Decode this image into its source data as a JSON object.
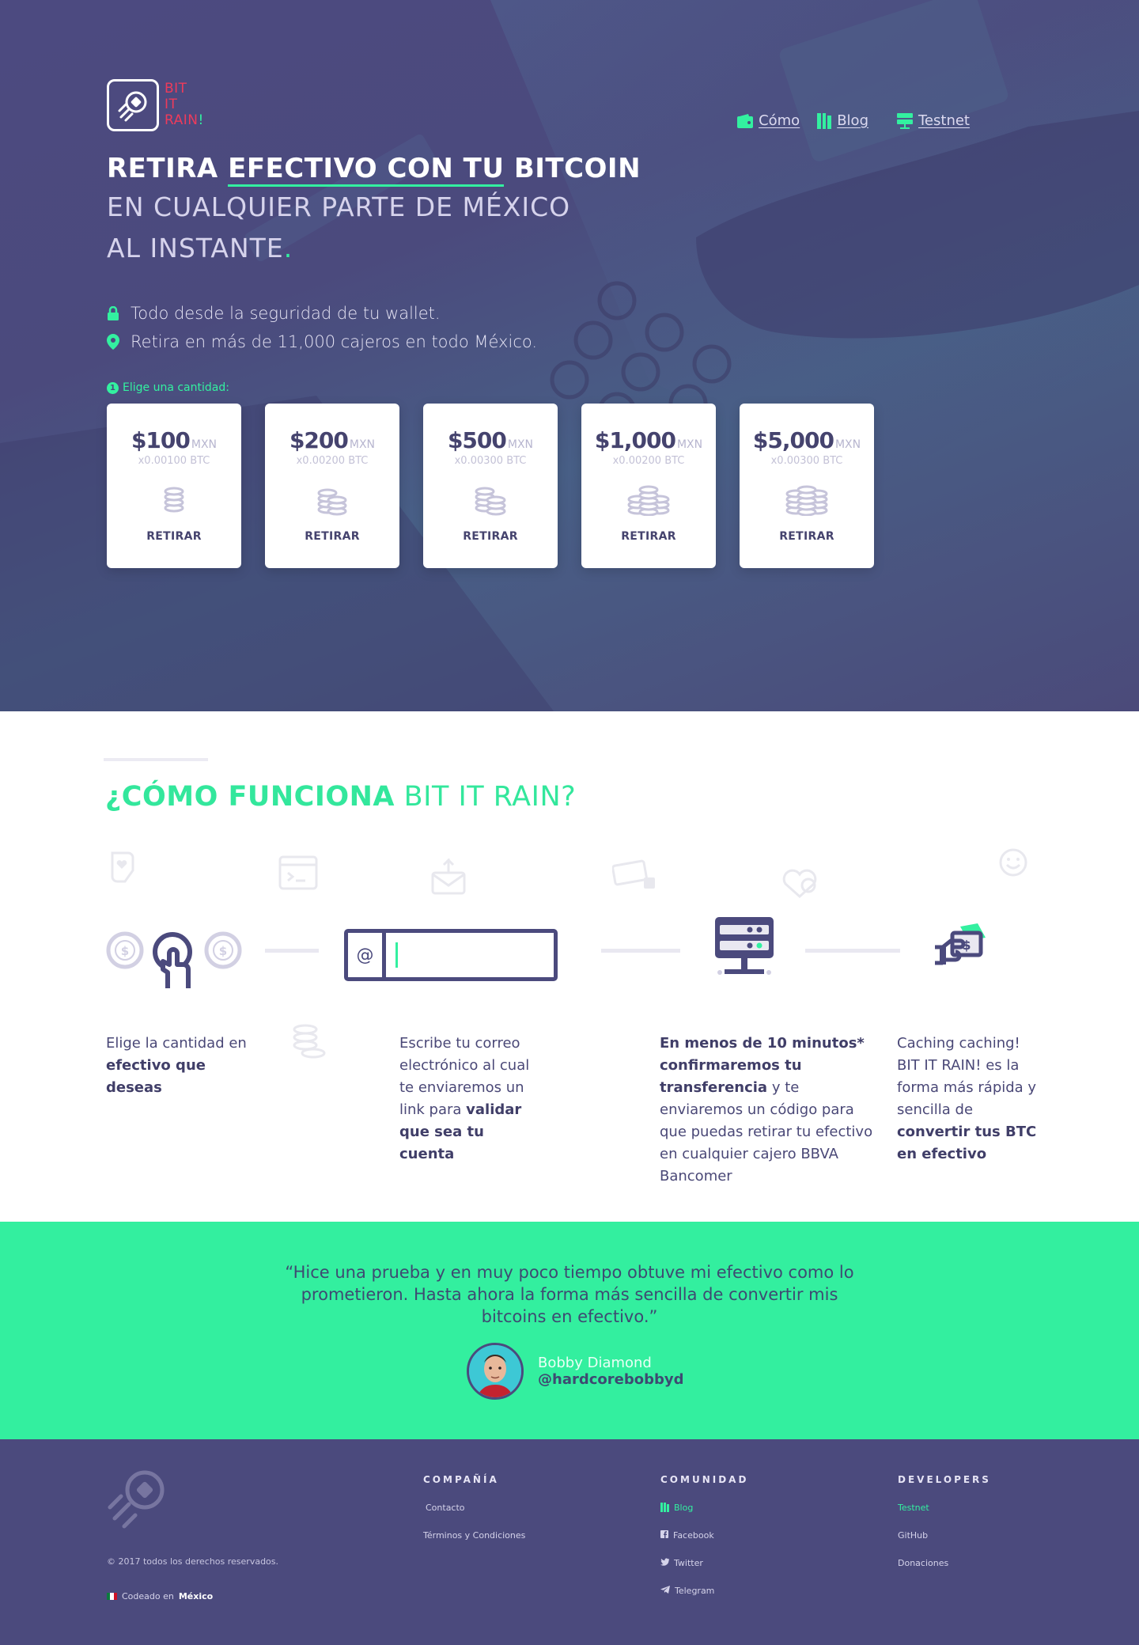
{
  "brand": {
    "logo_line1": "BIT",
    "logo_line2": "IT",
    "logo_line3": "RAIN",
    "logo_bang": "!",
    "colors": {
      "accent": "#33f0a0",
      "primary": "#4b4a7d",
      "logo_red": "#ee3b5b"
    }
  },
  "nav": {
    "items": [
      {
        "label": "Cómo",
        "icon": "wallet-icon"
      },
      {
        "label": "Blog",
        "icon": "blog-icon"
      },
      {
        "label": "Testnet",
        "icon": "server-icon"
      }
    ]
  },
  "hero": {
    "h1_pre": "RETIRA ",
    "h1_ul": "EFECTIVO CON TU",
    "h1_post": " BITCOIN",
    "h2_line1": "EN CUALQUIER PARTE DE MÉXICO",
    "h2_line2": "AL INSTANTE",
    "h2_dot": ".",
    "bullets": [
      {
        "text": "Todo desde la seguridad de tu wallet.",
        "icon": "lock-icon"
      },
      {
        "text": "Retira en más de 11,000 cajeros en todo México.",
        "icon": "map-pin-icon"
      }
    ],
    "choose_num": "1",
    "choose_label": "Elige una cantidad:"
  },
  "cards": [
    {
      "amount": "$100",
      "currency": "MXN",
      "btc": "x0.00100 BTC",
      "cta": "RETIRAR"
    },
    {
      "amount": "$200",
      "currency": "MXN",
      "btc": "x0.00200 BTC",
      "cta": "RETIRAR"
    },
    {
      "amount": "$500",
      "currency": "MXN",
      "btc": "x0.00300 BTC",
      "cta": "RETIRAR"
    },
    {
      "amount": "$1,000",
      "currency": "MXN",
      "btc": "x0.00200 BTC",
      "cta": "RETIRAR"
    },
    {
      "amount": "$5,000",
      "currency": "MXN",
      "btc": "x0.00300 BTC",
      "cta": "RETIRAR"
    }
  ],
  "how": {
    "title_bold": "¿CÓMO FUNCIONA",
    "title_light": " BIT IT RAIN?",
    "email_at": "@",
    "steps": [
      {
        "parts": [
          {
            "t": "Elige la cantidad en ",
            "b": false
          },
          {
            "t": "efectivo que deseas",
            "b": true
          }
        ]
      },
      {
        "parts": [
          {
            "t": "Escribe tu correo electrónico al cual te enviaremos un link para ",
            "b": false
          },
          {
            "t": "validar que sea tu cuenta",
            "b": true
          }
        ]
      },
      {
        "parts": [
          {
            "t": "En menos de 10 minutos* confirmaremos tu transferencia",
            "b": true
          },
          {
            "t": " y te enviaremos un código para que puedas retirar tu efectivo en cualquier cajero BBVA Bancomer",
            "b": false
          }
        ]
      },
      {
        "parts": [
          {
            "t": "Caching caching! BIT IT RAIN! es la forma más rápida y sencilla de ",
            "b": false
          },
          {
            "t": "convertir tus BTC en efectivo",
            "b": true
          }
        ]
      }
    ]
  },
  "testimonial": {
    "quote": "“Hice una prueba y en muy poco tiempo obtuve mi efectivo como lo prometieron. Hasta ahora la forma más sencilla de convertir mis bitcoins en efectivo.”",
    "name": "Bobby Diamond",
    "handle": "@hardcorebobbyd"
  },
  "footer": {
    "copyright": "© 2017 todos los derechos reservados.",
    "made_pre": "Codeado en ",
    "made_country": "México",
    "columns": [
      {
        "title": "COMPAÑÍA",
        "links": [
          {
            "label": "Contacto"
          },
          {
            "label": "Términos y Condiciones"
          }
        ]
      },
      {
        "title": "COMUNIDAD",
        "links": [
          {
            "label": "Blog",
            "icon": "blog-icon"
          },
          {
            "label": "Facebook",
            "icon": "facebook-icon"
          },
          {
            "label": "Twitter",
            "icon": "twitter-icon"
          },
          {
            "label": "Telegram",
            "icon": "telegram-icon"
          }
        ]
      },
      {
        "title": "DEVELOPERS",
        "links": [
          {
            "label": "Testnet"
          },
          {
            "label": "GitHub"
          },
          {
            "label": "Donaciones"
          }
        ]
      }
    ]
  }
}
